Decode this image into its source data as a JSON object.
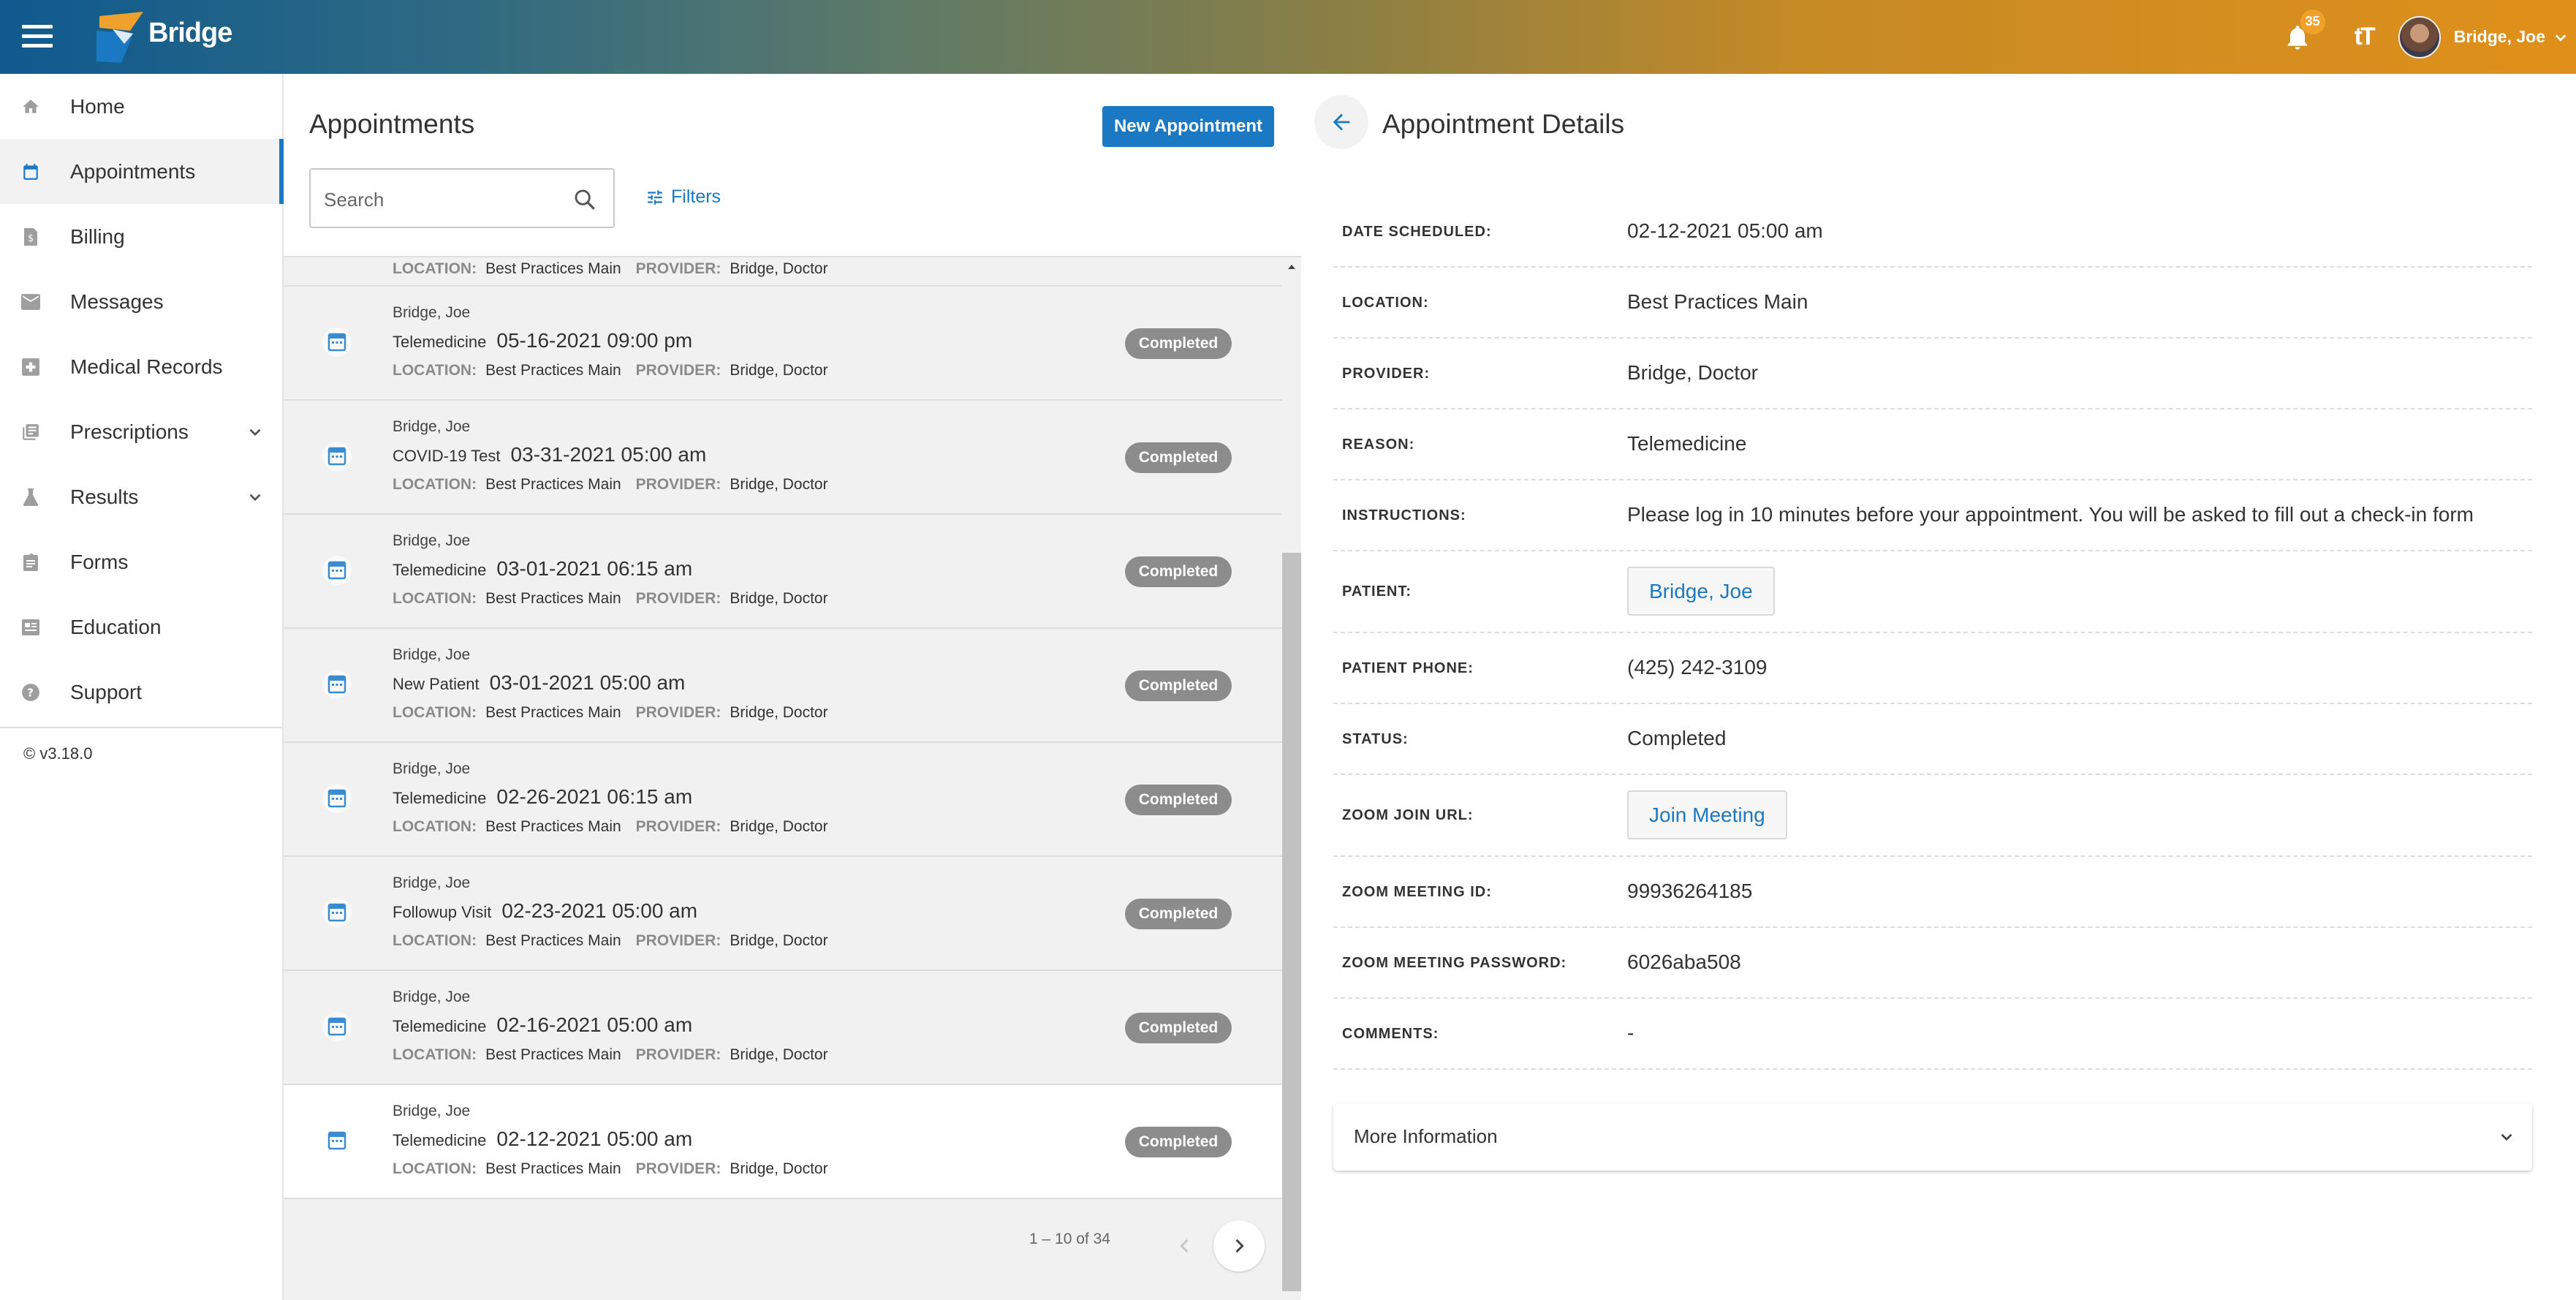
{
  "header": {
    "app_name": "Bridge",
    "notification_count": "35",
    "text_size_icon": "tT",
    "user_name": "Bridge, Joe",
    "gradient_colors": [
      "#0f5a8f",
      "#e0901a"
    ]
  },
  "sidebar": {
    "items": [
      {
        "label": "Home",
        "icon": "home-icon"
      },
      {
        "label": "Appointments",
        "icon": "calendar-icon",
        "active": true
      },
      {
        "label": "Billing",
        "icon": "billing-icon"
      },
      {
        "label": "Messages",
        "icon": "mail-icon"
      },
      {
        "label": "Medical Records",
        "icon": "medical-records-icon"
      },
      {
        "label": "Prescriptions",
        "icon": "prescriptions-icon",
        "expandable": true
      },
      {
        "label": "Results",
        "icon": "flask-icon",
        "expandable": true
      },
      {
        "label": "Forms",
        "icon": "clipboard-icon"
      },
      {
        "label": "Education",
        "icon": "education-icon"
      },
      {
        "label": "Support",
        "icon": "help-icon"
      }
    ],
    "version": "© v3.18.0"
  },
  "list": {
    "title": "Appointments",
    "new_button": "New Appointment",
    "search_placeholder": "Search",
    "filters_label": "Filters",
    "location_label": "LOCATION:",
    "provider_label": "PROVIDER:",
    "partial_row": {
      "location": "Best Practices Main",
      "provider": "Bridge, Doctor"
    },
    "rows": [
      {
        "patient": "Bridge, Joe",
        "type": "Telemedicine",
        "date": "05-16-2021 09:00 pm",
        "location": "Best Practices Main",
        "provider": "Bridge, Doctor",
        "status": "Completed"
      },
      {
        "patient": "Bridge, Joe",
        "type": "COVID-19 Test",
        "date": "03-31-2021 05:00 am",
        "location": "Best Practices Main",
        "provider": "Bridge, Doctor",
        "status": "Completed"
      },
      {
        "patient": "Bridge, Joe",
        "type": "Telemedicine",
        "date": "03-01-2021 06:15 am",
        "location": "Best Practices Main",
        "provider": "Bridge, Doctor",
        "status": "Completed"
      },
      {
        "patient": "Bridge, Joe",
        "type": "New Patient",
        "date": "03-01-2021 05:00 am",
        "location": "Best Practices Main",
        "provider": "Bridge, Doctor",
        "status": "Completed"
      },
      {
        "patient": "Bridge, Joe",
        "type": "Telemedicine",
        "date": "02-26-2021 06:15 am",
        "location": "Best Practices Main",
        "provider": "Bridge, Doctor",
        "status": "Completed"
      },
      {
        "patient": "Bridge, Joe",
        "type": "Followup Visit",
        "date": "02-23-2021 05:00 am",
        "location": "Best Practices Main",
        "provider": "Bridge, Doctor",
        "status": "Completed"
      },
      {
        "patient": "Bridge, Joe",
        "type": "Telemedicine",
        "date": "02-16-2021 05:00 am",
        "location": "Best Practices Main",
        "provider": "Bridge, Doctor",
        "status": "Completed"
      },
      {
        "patient": "Bridge, Joe",
        "type": "Telemedicine",
        "date": "02-12-2021 05:00 am",
        "location": "Best Practices Main",
        "provider": "Bridge, Doctor",
        "status": "Completed",
        "selected": true
      }
    ],
    "pagination": "1 – 10 of 34"
  },
  "details": {
    "title": "Appointment Details",
    "fields": [
      {
        "label": "DATE SCHEDULED:",
        "value": "02-12-2021 05:00 am",
        "kind": "text"
      },
      {
        "label": "LOCATION:",
        "value": "Best Practices Main",
        "kind": "text"
      },
      {
        "label": "PROVIDER:",
        "value": "Bridge, Doctor",
        "kind": "text"
      },
      {
        "label": "REASON:",
        "value": "Telemedicine",
        "kind": "text"
      },
      {
        "label": "INSTRUCTIONS:",
        "value": "Please log in 10 minutes before your appointment. You will be asked to fill out a check-in form",
        "kind": "text"
      },
      {
        "label": "PATIENT:",
        "value": "Bridge, Joe",
        "kind": "button"
      },
      {
        "label": "PATIENT PHONE:",
        "value": "(425) 242-3109",
        "kind": "text"
      },
      {
        "label": "STATUS:",
        "value": "Completed",
        "kind": "text"
      },
      {
        "label": "ZOOM JOIN URL:",
        "value": "Join Meeting",
        "kind": "button"
      },
      {
        "label": "ZOOM MEETING ID:",
        "value": "99936264185",
        "kind": "text"
      },
      {
        "label": "ZOOM MEETING PASSWORD:",
        "value": "6026aba508",
        "kind": "text"
      },
      {
        "label": "COMMENTS:",
        "value": "-",
        "kind": "text"
      }
    ],
    "more_info": "More Information"
  },
  "colors": {
    "accent": "#1a79c2",
    "status_badge": "#8c8c8c",
    "list_bg": "#f1f1f1"
  }
}
